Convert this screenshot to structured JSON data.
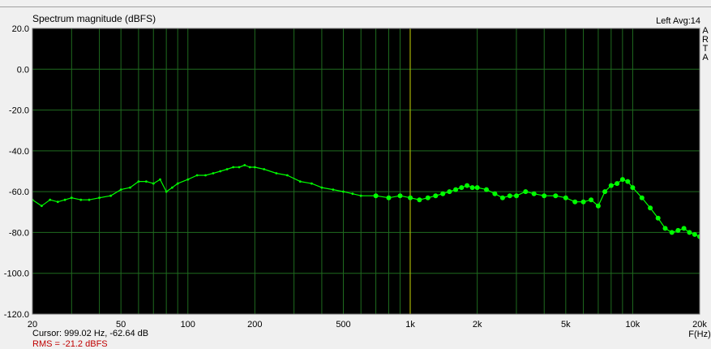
{
  "chart_data": {
    "type": "line",
    "title": "Spectrum magnitude (dBFS)",
    "xlabel": "F(Hz)",
    "ylabel": "",
    "xscale": "log",
    "xlim": [
      20,
      20000
    ],
    "ylim": [
      -120,
      20
    ],
    "grid": true,
    "y_ticks": [
      "20.0",
      "0.0",
      "-20.0",
      "-40.0",
      "-60.0",
      "-80.0",
      "-100.0",
      "-120.0"
    ],
    "x_ticks": [
      {
        "value": 20,
        "label": "20"
      },
      {
        "value": 50,
        "label": "50"
      },
      {
        "value": 100,
        "label": "100"
      },
      {
        "value": 200,
        "label": "200"
      },
      {
        "value": 500,
        "label": "500"
      },
      {
        "value": 1000,
        "label": "1k"
      },
      {
        "value": 2000,
        "label": "2k"
      },
      {
        "value": 5000,
        "label": "5k"
      },
      {
        "value": 10000,
        "label": "10k"
      },
      {
        "value": 20000,
        "label": "20k"
      }
    ],
    "series": [
      {
        "x": [
          20,
          22,
          24,
          26,
          28,
          30,
          33,
          36,
          40,
          45,
          50,
          55,
          60,
          65,
          70,
          75,
          80,
          85,
          90,
          100,
          110,
          120,
          130,
          140,
          150,
          160,
          170,
          180,
          190,
          200,
          220,
          250,
          280,
          320,
          360,
          400,
          450,
          500,
          550,
          600,
          700,
          800,
          900,
          1000,
          1100,
          1200,
          1300,
          1400,
          1500,
          1600,
          1700,
          1800,
          1900,
          2000,
          2200,
          2400,
          2600,
          2800,
          3000,
          3300,
          3600,
          4000,
          4500,
          5000,
          5500,
          6000,
          6500,
          7000,
          7500,
          8000,
          8500,
          9000,
          9500,
          10000,
          11000,
          12000,
          13000,
          14000,
          15000,
          16000,
          17000,
          18000,
          19000,
          20000
        ],
        "y": [
          -64,
          -67,
          -64,
          -65,
          -64,
          -63,
          -64,
          -64,
          -63,
          -62,
          -59,
          -58,
          -55,
          -55,
          -56,
          -54,
          -60,
          -58,
          -56,
          -54,
          -52,
          -52,
          -51,
          -50,
          -49,
          -48,
          -48,
          -47,
          -48,
          -48,
          -49,
          -51,
          -52,
          -55,
          -56,
          -58,
          -59,
          -60,
          -61,
          -62,
          -62,
          -63,
          -62,
          -63,
          -64,
          -63,
          -62,
          -61,
          -60,
          -59,
          -58,
          -57,
          -58,
          -58,
          -59,
          -61,
          -63,
          -62,
          -62,
          -60,
          -61,
          -62,
          -62,
          -63,
          -65,
          -65,
          -64,
          -67,
          -60,
          -57,
          -56,
          -54,
          -55,
          -58,
          -63,
          -68,
          -73,
          -78,
          -80,
          -79,
          -78,
          -80,
          -81,
          -82
        ]
      }
    ],
    "colors": {
      "plot_background": "#000000",
      "grid": "#1f6b1f",
      "trace": "#00ff00",
      "cursor": "#c8c800"
    }
  },
  "header": {
    "title": "Spectrum magnitude (dBFS)",
    "channel_info": "Left  Avg:14",
    "watermark": [
      "A",
      "R",
      "T",
      "A"
    ]
  },
  "footer": {
    "cursor": "Cursor: 999.02 Hz, -62.64 dB",
    "rms": "RMS = -21.2 dBFS"
  },
  "cursor_marker": {
    "frequency": 999.02
  }
}
